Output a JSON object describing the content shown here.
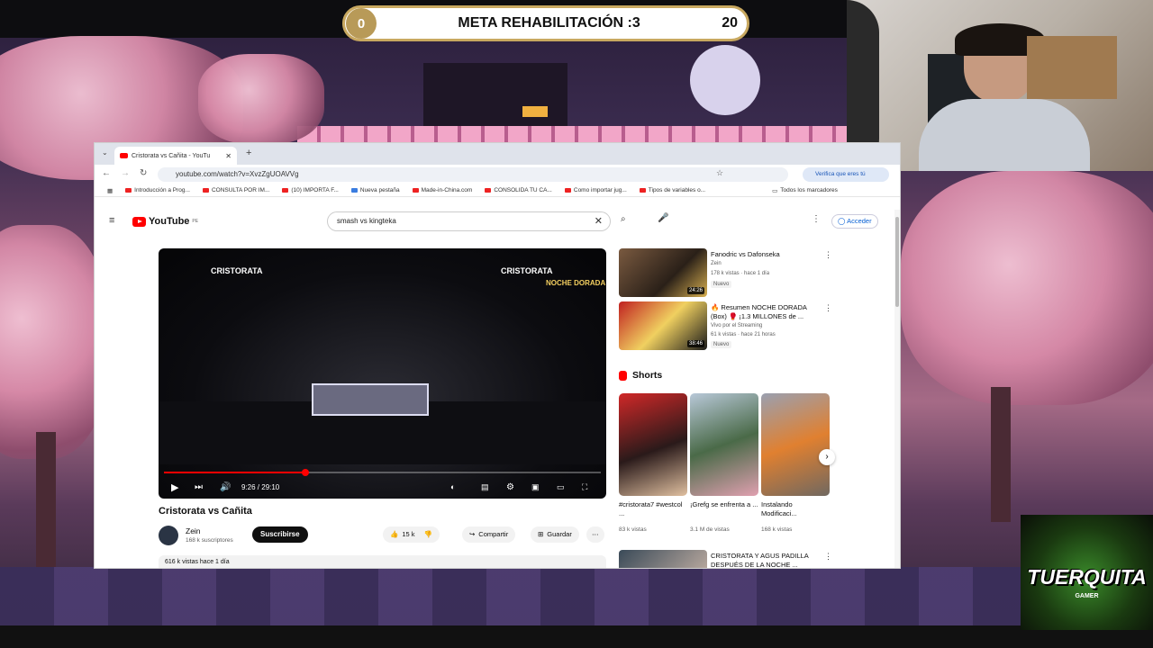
{
  "overlay": {
    "goal_current": "0",
    "goal_title": "META REHABILITACIÓN :3",
    "goal_max": "20",
    "logo_text": "TUERQUITA",
    "logo_sub": "GAMER"
  },
  "browser": {
    "tab_title": "Cristorata vs Cañita - YouTu",
    "url": "youtube.com/watch?v=XvzZgUOAVVg",
    "profile_text": "Verifica que eres tú",
    "bookmarks": [
      "Introducción a Prog...",
      "CONSULTA POR IM...",
      "(10) IMPORTA F...",
      "Nueva pestaña",
      "Made-in-China.com",
      "CONSOLIDA TU CA...",
      "Como importar jug...",
      "Tipos de variables o..."
    ],
    "all_bookmarks": "Todos los marcadores"
  },
  "youtube": {
    "logo": "YouTube",
    "country": "PE",
    "search_query": "smash vs kingteka",
    "signin": "Acceder",
    "video": {
      "title": "Cristorata vs Cañita",
      "time": "9:26 / 29:10",
      "progress": 0.324,
      "overlay_left": "CRISTORATA",
      "overlay_right": "CRISTORATA",
      "overlay_brand": "NOCHE DORADA"
    },
    "channel": {
      "name": "Zein",
      "subs": "168 k suscriptores",
      "subscribe": "Suscribirse"
    },
    "actions": {
      "likes": "15 k",
      "share": "Compartir",
      "save": "Guardar"
    },
    "meta": "616 k vistas  hace 1 día",
    "recs": [
      {
        "title": "Fanodric vs Dafonseka",
        "channel": "Zein",
        "meta": "178 k vistas · hace 1 día",
        "badge": "Nuevo",
        "duration": "24:26"
      },
      {
        "title": "🔥 Resumen NOCHE DORADA (Box) 🥊 ¡1.3 MILLONES de ...",
        "channel": "Vivo por el Streaming",
        "meta": "61 k vistas · hace 21 horas",
        "badge": "Nuevo",
        "duration": "38:46"
      },
      {
        "title": "CRISTORATA Y AGUS PADILLA DESPUÉS DE LA NOCHE ...",
        "channel": "",
        "meta": "",
        "badge": "",
        "duration": ""
      }
    ],
    "shorts_label": "Shorts",
    "shorts": [
      {
        "title": "#cristorata7 #westcol ...",
        "views": "83 k vistas"
      },
      {
        "title": "¡Grefg se enfrenta a ...",
        "views": "3.1 M de vistas"
      },
      {
        "title": "Instalando Modificaci...",
        "views": "168 k vistas"
      }
    ]
  },
  "colors": {
    "yt_red": "#ff0000",
    "goal_gold": "#b89a58",
    "logo_green": "#3a8a2a"
  }
}
